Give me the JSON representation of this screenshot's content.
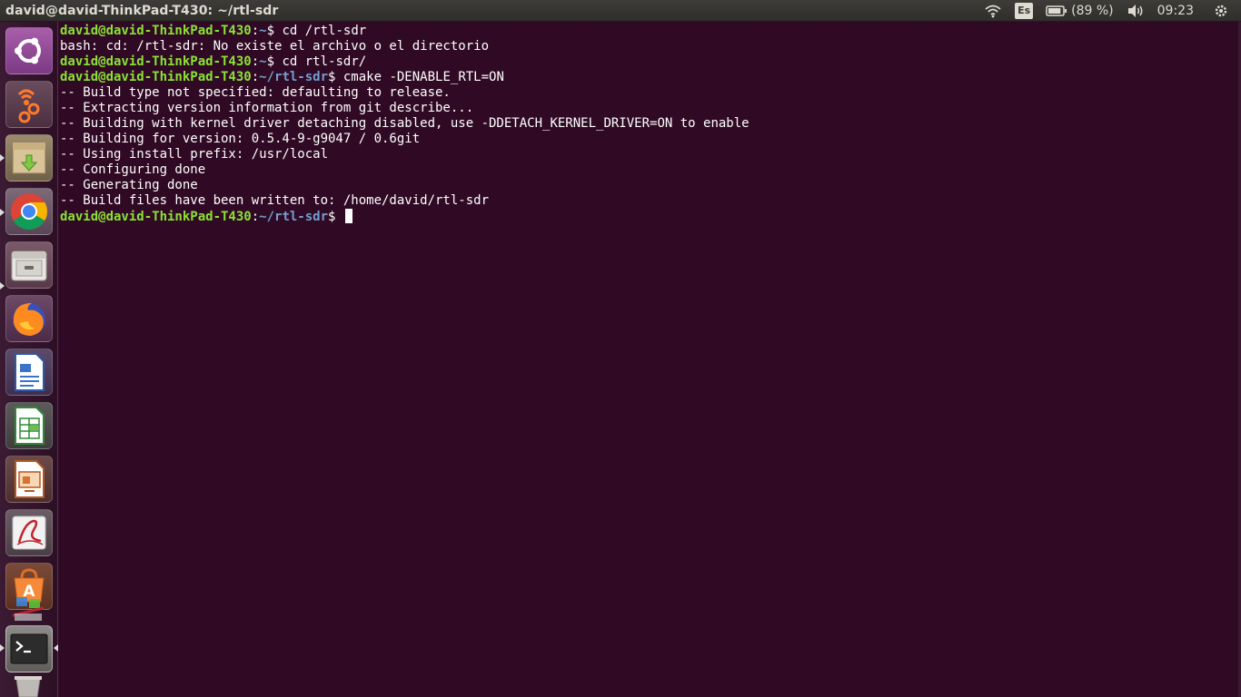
{
  "top_panel": {
    "window_title": "david@david-ThinkPad-T430: ~/rtl-sdr",
    "keyboard_layout": "Es",
    "battery_text": "(89 %)",
    "battery_level": 0.89,
    "clock": "09:23",
    "icons": [
      "wifi-icon",
      "battery-icon",
      "volume-icon",
      "gear-icon"
    ]
  },
  "launcher": {
    "items": [
      {
        "name": "dash-button",
        "icon": "ubuntu-logo-icon"
      },
      {
        "name": "launcher-sdr-app",
        "icon": "sdr-app-icon"
      },
      {
        "name": "launcher-archive-manager",
        "icon": "archive-download-icon"
      },
      {
        "name": "launcher-chrome",
        "icon": "chrome-icon"
      },
      {
        "name": "launcher-files",
        "icon": "file-cabinet-icon"
      },
      {
        "name": "launcher-firefox",
        "icon": "firefox-icon"
      },
      {
        "name": "launcher-writer",
        "icon": "writer-icon"
      },
      {
        "name": "launcher-calc",
        "icon": "calc-icon"
      },
      {
        "name": "launcher-impress",
        "icon": "impress-icon"
      },
      {
        "name": "launcher-pdf-viewer",
        "icon": "pdf-icon"
      },
      {
        "name": "launcher-software-center",
        "icon": "software-center-icon"
      },
      {
        "name": "launcher-terminal",
        "icon": "terminal-icon"
      }
    ]
  },
  "colors": {
    "terminal_bg": "#300a24",
    "prompt_user": "#8ae234",
    "prompt_path": "#729fcf",
    "text": "#ffffff"
  },
  "terminal": {
    "lines": [
      {
        "user": "david@david-ThinkPad-T430",
        "sep": ":",
        "path": "~",
        "dollar": "$",
        "cmd": " cd /rtl-sdr"
      },
      {
        "out": "bash: cd: /rtl-sdr: No existe el archivo o el directorio"
      },
      {
        "user": "david@david-ThinkPad-T430",
        "sep": ":",
        "path": "~",
        "dollar": "$",
        "cmd": " cd rtl-sdr/"
      },
      {
        "user": "david@david-ThinkPad-T430",
        "sep": ":",
        "path": "~/rtl-sdr",
        "dollar": "$",
        "cmd": " cmake -DENABLE_RTL=ON"
      },
      {
        "out": "-- Build type not specified: defaulting to release."
      },
      {
        "out": "-- Extracting version information from git describe..."
      },
      {
        "out": "-- Building with kernel driver detaching disabled, use -DDETACH_KERNEL_DRIVER=ON to enable"
      },
      {
        "out": "-- Building for version: 0.5.4-9-g9047 / 0.6git"
      },
      {
        "out": "-- Using install prefix: /usr/local"
      },
      {
        "out": "-- Configuring done"
      },
      {
        "out": "-- Generating done"
      },
      {
        "out": "-- Build files have been written to: /home/david/rtl-sdr"
      },
      {
        "user": "david@david-ThinkPad-T430",
        "sep": ":",
        "path": "~/rtl-sdr",
        "dollar": "$",
        "cmd": " ",
        "cursor": true
      }
    ]
  }
}
